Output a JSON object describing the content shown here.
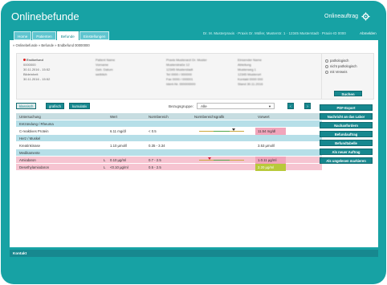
{
  "app": {
    "title": "Onlinebefunde",
    "order_link": "Onlineauftrag"
  },
  "header": {
    "user_info": "Dr. M. Musterpraxis · Praxis Dr. Müller, Musterstr. 1 · 12345 Musterstadt · Praxis-ID 0000",
    "logout": "Abmelden"
  },
  "tabs": [
    {
      "label": "Home",
      "active": false
    },
    {
      "label": "Patienten",
      "active": false
    },
    {
      "label": "Befunde",
      "active": true
    },
    {
      "label": "Einstellungen",
      "active": false
    }
  ],
  "breadcrumb": "» Onlinebefunde » Befunde » Endbefund 00000000",
  "patient": {
    "status": "Endbefund",
    "id": "0000000",
    "received_date": "30.11.2016 - 15:52",
    "entry_label": "Bildeinheit",
    "entry_date": "30.11.2016 - 15:52",
    "col2": [
      "Patient Name",
      "Vorname",
      "Geb. Datum",
      "weiblich"
    ],
    "col3": [
      "Praxis Musterarzt Dr. Muster",
      "Musterstraße 12",
      "12345 Musterstadt",
      "Tel 0000 / 000000",
      "Fax 0000 / 000001",
      "Ident-Nr. 000000000"
    ],
    "col4": [
      "Einsender Name",
      "Abteilung",
      "Musterweg 1",
      "12345 Musterort",
      "Kontakt 0000 000",
      "Stand 30.11.2016"
    ]
  },
  "filter": {
    "options": [
      "pathologisch",
      "nicht pathologisch",
      "mit Verweis"
    ],
    "search_label": "Suchen"
  },
  "toolbar": {
    "view_buttons": [
      "klassisch",
      "grafisch",
      "kumulativ"
    ],
    "active_view": "grafisch",
    "ref_label": "Bezugsgruppe:",
    "ref_value": "Alle",
    "prev_btn": "‹",
    "next_btn": "›"
  },
  "table": {
    "headers": {
      "test": "Untersuchung",
      "value": "Wert",
      "ref": "Normbereich",
      "graph": "Normbereichsgrafik",
      "prev": "Vorwert"
    },
    "rows": [
      {
        "type": "group",
        "test": "Entzündung / Rheuma"
      },
      {
        "type": "data",
        "alert": false,
        "test": "C-reaktives Protein",
        "flag": "",
        "value": "6.11 mg/dl",
        "ref": "< 0.5",
        "prev": "11.54 mg/dl",
        "prev_style": "pink",
        "marker": 0.76,
        "marker_color": "dark"
      },
      {
        "type": "group",
        "test": "Herz / Muskel"
      },
      {
        "type": "data",
        "alert": false,
        "test": "Kreatinkinase",
        "flag": "",
        "value": "1.10 µmol/l",
        "ref": "0.35 - 3.34",
        "prev": "3.53 µmol/l",
        "prev_style": "none"
      },
      {
        "type": "group",
        "test": "Medikamente"
      },
      {
        "type": "data",
        "alert": true,
        "test": "Amiodaron",
        "flag": "L",
        "value": "0.10 µg/ml",
        "ref": "0.7 - 2.5",
        "prev": "1.0.11 µg/ml",
        "prev_style": "pink",
        "marker": 0.24,
        "marker_color": "red"
      },
      {
        "type": "data",
        "alert": true,
        "test": "Desethylamiodaron",
        "flag": "L",
        "value": "<0.10 µg/ml",
        "ref": "0.5 - 2.5",
        "prev": "2.20 µg/ml",
        "prev_style": "green"
      }
    ]
  },
  "actions": [
    "PDF-Export",
    "Nachricht an das Labor",
    "Nachanfordern",
    "Befundauftrag",
    "Befundtabelle",
    "Als neuer Auftrag",
    "Als ungelesen markieren"
  ],
  "footer": {
    "contact": "Kontakt"
  },
  "colors": {
    "brand": "#17a2a4",
    "button": "#17888f",
    "alert_row": "#f6c4d1",
    "group_row": "#b6dfe8"
  }
}
